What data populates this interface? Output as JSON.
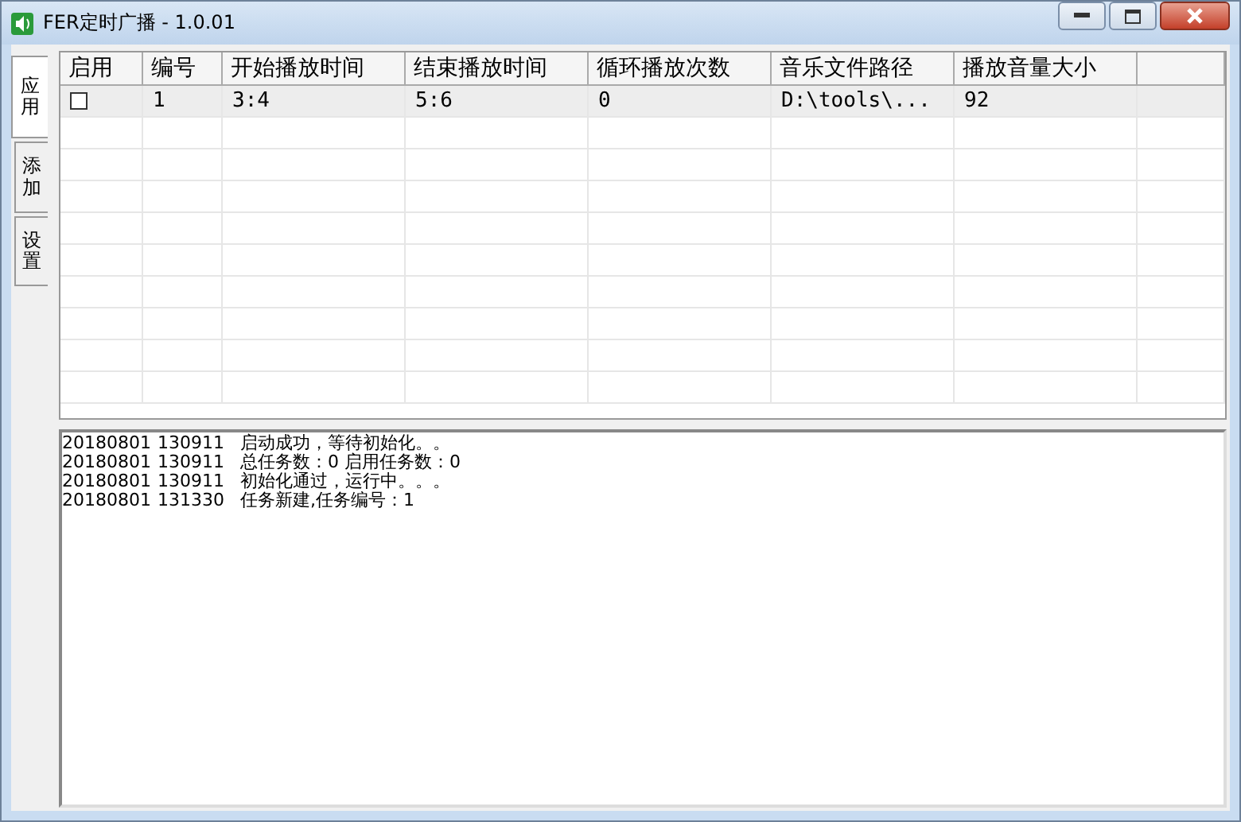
{
  "window": {
    "title": "FER定时广播 - 1.0.01"
  },
  "tabs": [
    {
      "label": "应用",
      "selected": true
    },
    {
      "label": "添加",
      "selected": false
    },
    {
      "label": "设置",
      "selected": false
    }
  ],
  "table": {
    "columns": [
      "启用",
      "编号",
      "开始播放时间",
      "结束播放时间",
      "循环播放次数",
      "音乐文件路径",
      "播放音量大小"
    ],
    "rows": [
      {
        "checked": false,
        "cells": [
          "",
          "1",
          "3:4",
          "5:6",
          "0",
          "D:\\tools\\...",
          "92"
        ]
      }
    ]
  },
  "log": [
    {
      "date": "20180801",
      "time": "130911",
      "message": "启动成功，等待初始化。。"
    },
    {
      "date": "20180801",
      "time": "130911",
      "message": "总任务数：0 启用任务数：0"
    },
    {
      "date": "20180801",
      "time": "130911",
      "message": "初始化通过，运行中。。。"
    },
    {
      "date": "20180801",
      "time": "131330",
      "message": "任务新建,任务编号：1"
    }
  ]
}
